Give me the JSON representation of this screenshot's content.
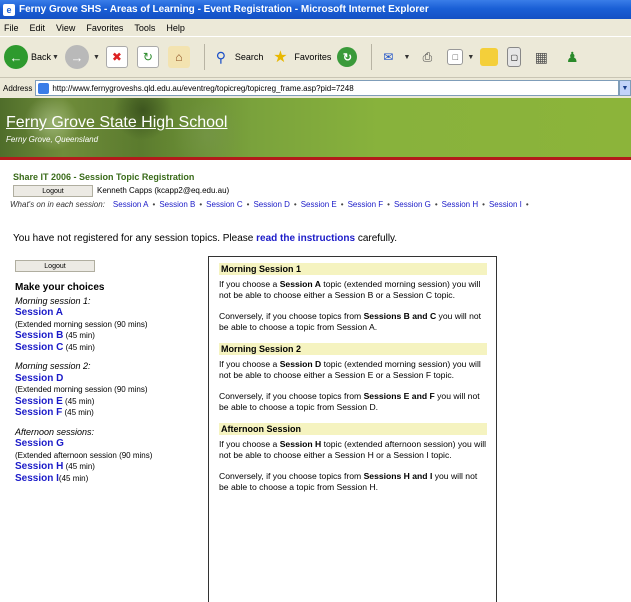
{
  "window": {
    "title": "Ferny Grove SHS - Areas of Learning - Event Registration - Microsoft Internet Explorer"
  },
  "menu": {
    "items": [
      "File",
      "Edit",
      "View",
      "Favorites",
      "Tools",
      "Help"
    ]
  },
  "toolbar": {
    "back": "Back",
    "search": "Search",
    "favorites": "Favorites"
  },
  "address": {
    "label": "Address",
    "url": "http://www.fernygroveshs.qld.edu.au/eventreg/topicreg/topicreg_frame.asp?pid=7248"
  },
  "banner": {
    "school": "Ferny Grove State High School",
    "location": "Ferny Grove, Queensland"
  },
  "page": {
    "event_title": "Share IT 2006 - Session Topic Registration",
    "logout": "Logout",
    "user": "Kenneth Capps (kcapp2@eq.edu.au)",
    "whats_on_label": "What's on in each session:",
    "sessions": [
      "Session A",
      "Session B",
      "Session C",
      "Session D",
      "Session E",
      "Session F",
      "Session G",
      "Session H",
      "Session I"
    ],
    "notice_pre": "You have not registered for any session topics. Please",
    "notice_link": "read the instructions",
    "notice_post": "carefully."
  },
  "choices": {
    "heading": "Make your choices",
    "morning1": "Morning session 1:",
    "morning2": "Morning session 2:",
    "afternoon": "Afternoon sessions:",
    "a": "Session A",
    "a_note": "(Extended morning session (90 mins)",
    "b": "Session B",
    "b_dur": "(45 min)",
    "c": "Session C",
    "c_dur": "(45 min)",
    "d": "Session D",
    "d_note": "(Extended morning session (90 mins)",
    "e": "Session E",
    "e_dur": "(45 min)",
    "f": "Session F",
    "f_dur": "(45 min)",
    "g": "Session G",
    "g_note": "(Extended afternoon session (90 mins)",
    "h": "Session H",
    "h_dur": "(45 min)",
    "i": "Session I",
    "i_dur": "(45 min)"
  },
  "panel": {
    "m1_head": "Morning Session 1",
    "m1_p1": [
      "If you choose a ",
      "Session A",
      " topic (extended morning session) you will not be able to choose either a Session B or a Session C topic."
    ],
    "m1_p2": [
      "Conversely, if you choose topics from ",
      "Sessions B and C",
      " you will not be able to choose a topic from Session A."
    ],
    "m2_head": "Morning Session 2",
    "m2_p1": [
      "If you choose a ",
      "Session D",
      " topic (extended morning session) you will not be able to choose either a Session E or a Session F topic."
    ],
    "m2_p2": [
      "Conversely, if you choose topics from ",
      "Sessions E and F",
      " you will not be able to choose a topic from Session D."
    ],
    "af_head": "Afternoon Session",
    "af_p1": [
      "If you choose a ",
      "Session H",
      " topic (extended afternoon session) you will not be able to choose either a Session H or a Session I topic."
    ],
    "af_p2": [
      "Conversely, if you choose topics from ",
      "Sessions H and I",
      " you will not be able to choose a topic from Session H."
    ]
  }
}
